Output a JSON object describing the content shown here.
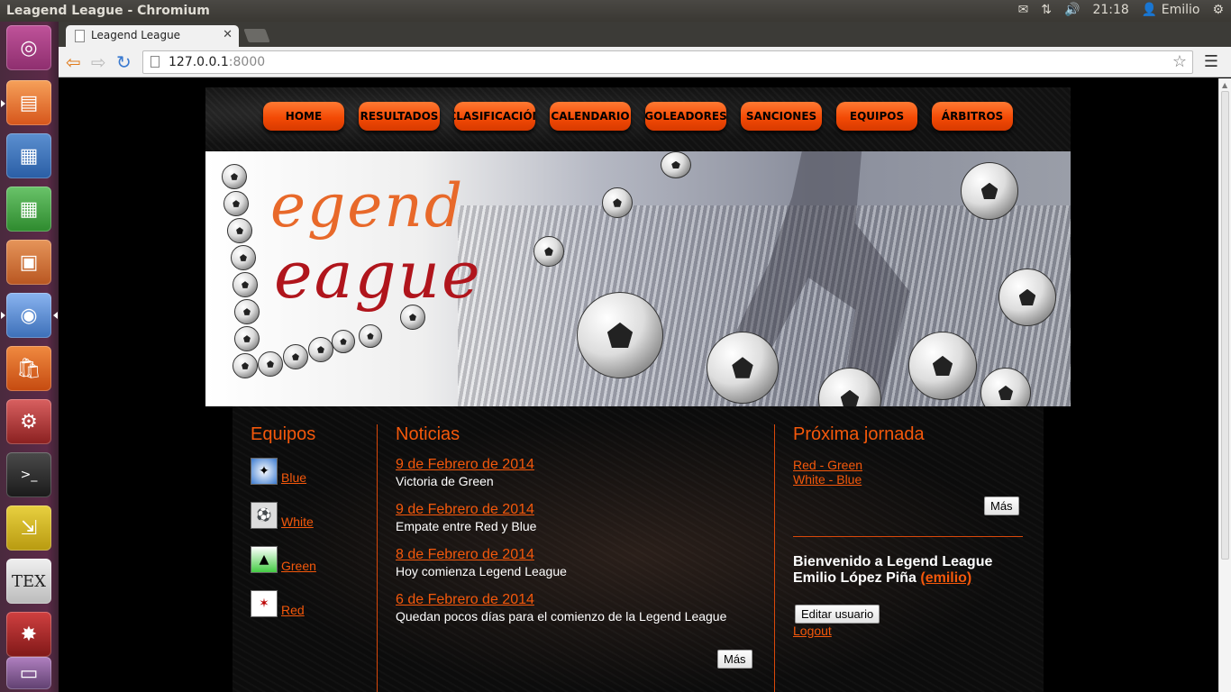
{
  "window": {
    "title": "Leagend League - Chromium"
  },
  "panel": {
    "time": "21:18",
    "user": "Emilio"
  },
  "browser": {
    "tab_title": "Leagend League",
    "url_host": "127.0.0.1",
    "url_port": ":8000"
  },
  "site": {
    "menu": [
      "HOME",
      "RESULTADOS",
      "CLASIFICACIÓN",
      "CALENDARIO",
      "GOLEADORES",
      "SANCIONES",
      "EQUIPOS",
      "ÁRBITROS"
    ],
    "logo_line1": "egend",
    "logo_line2": "eague",
    "teams": {
      "title": "Equipos",
      "items": [
        "Blue",
        "White",
        "Green",
        "Red"
      ]
    },
    "news": {
      "title": "Noticias",
      "items": [
        {
          "date": "9 de Febrero de 2014",
          "text": "Victoria de Green"
        },
        {
          "date": "9 de Febrero de 2014",
          "text": "Empate entre Red y Blue"
        },
        {
          "date": "8 de Febrero de 2014",
          "text": "Hoy comienza Legend League"
        },
        {
          "date": "6 de Febrero de 2014",
          "text": "Quedan pocos días para el comienzo de la Legend League"
        }
      ],
      "more": "Más"
    },
    "next": {
      "title": "Próxima jornada",
      "matches": [
        "Red - Green",
        "White - Blue"
      ],
      "more": "Más"
    },
    "user": {
      "welcome": "Bienvenido a Legend League",
      "name": "Emilio López Piña",
      "username": "(emilio)",
      "edit": "Editar usuario",
      "logout": "Logout"
    }
  }
}
